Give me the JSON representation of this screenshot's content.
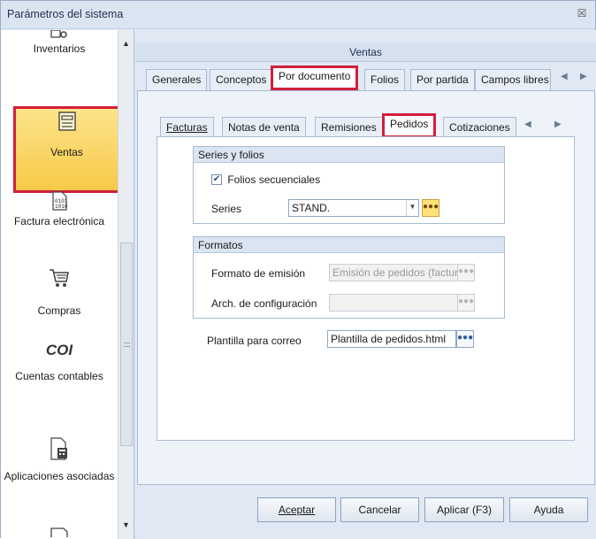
{
  "window": {
    "title": "Parámetros del sistema",
    "close_glyph": "☒"
  },
  "sidebar": {
    "items": [
      {
        "label": "Inventarios",
        "icon": "inventory-icon"
      },
      {
        "label": "Ventas",
        "icon": "register-icon"
      },
      {
        "label": "Factura electrónica",
        "icon": "binary-doc-icon"
      },
      {
        "label": "Compras",
        "icon": "cart-icon"
      },
      {
        "label": "Cuentas contables",
        "icon": "coi-icon",
        "icon_text": "COI"
      },
      {
        "label": "Aplicaciones asociadas",
        "icon": "calculator-doc-icon"
      }
    ]
  },
  "header": {
    "title": "Ventas"
  },
  "top_tabs": [
    "Generales",
    "Conceptos",
    "Por documento",
    "Folios",
    "Por partida",
    "Campos libres"
  ],
  "doc_tabs": [
    "Facturas",
    "Notas de venta",
    "Remisiones",
    "Pedidos",
    "Cotizaciones"
  ],
  "series_group": {
    "title": "Series y folios",
    "checkbox_label": "Folios secuenciales",
    "checkbox_checked": true,
    "series_label": "Series",
    "series_value": "STAND."
  },
  "formatos_group": {
    "title": "Formatos",
    "emision_label": "Formato de emisión",
    "emision_value": "Emisión de pedidos (factura",
    "config_label": "Arch. de configuración",
    "config_value": ""
  },
  "plantilla": {
    "label": "Plantilla para correo",
    "value": "Plantilla de pedidos.html"
  },
  "buttons": {
    "accept": "Aceptar",
    "cancel": "Cancelar",
    "apply": "Aplicar (F3)",
    "help": "Ayuda"
  },
  "colors": {
    "highlight": "#d21f3c",
    "selected_bg": "#f7c948"
  }
}
